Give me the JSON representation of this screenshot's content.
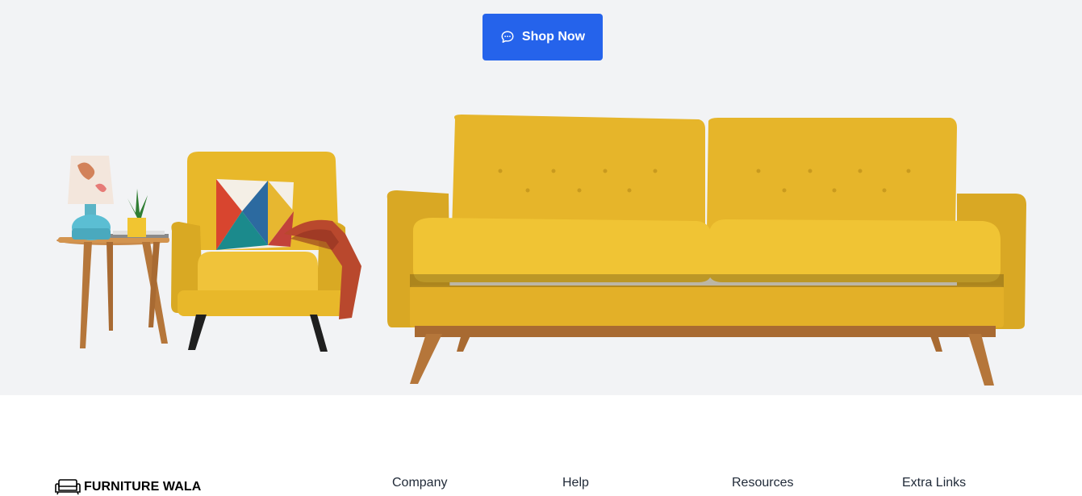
{
  "hero": {
    "cta_label": "Shop Now",
    "cta_icon": "chat-bubble-icon",
    "product_image": "living-room-furniture-set",
    "colors": {
      "background": "#f2f3f5",
      "button": "#2563eb",
      "sofa_yellow": "#e8b82a",
      "wood": "#b5763a"
    }
  },
  "footer": {
    "brand": {
      "name": "FURNITURE WALA",
      "icon": "sofa-icon"
    },
    "columns": [
      {
        "heading": "Company"
      },
      {
        "heading": "Help"
      },
      {
        "heading": "Resources"
      },
      {
        "heading": "Extra Links"
      }
    ]
  }
}
